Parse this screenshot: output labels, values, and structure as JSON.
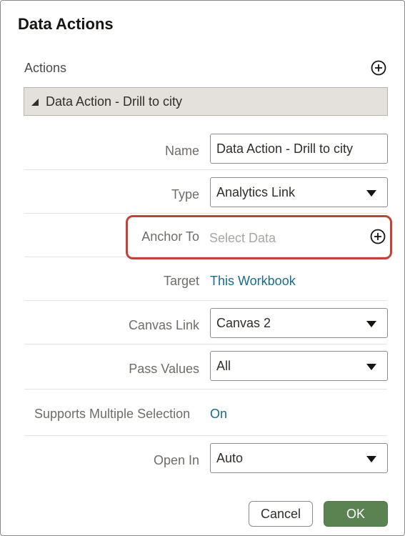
{
  "dialog": {
    "title": "Data Actions"
  },
  "actions": {
    "label": "Actions",
    "add_icon": "add-circle-icon"
  },
  "section": {
    "label": "Data Action - Drill to city",
    "collapse_icon": "triangle-expanded-icon"
  },
  "fields": {
    "name": {
      "label": "Name",
      "value": "Data Action - Drill to city"
    },
    "type": {
      "label": "Type",
      "value": "Analytics Link"
    },
    "anchor_to": {
      "label": "Anchor To",
      "placeholder": "Select Data",
      "add_icon": "add-circle-icon"
    },
    "target": {
      "label": "Target",
      "value": "This Workbook"
    },
    "canvas_link": {
      "label": "Canvas Link",
      "value": "Canvas 2"
    },
    "pass_values": {
      "label": "Pass Values",
      "value": "All"
    },
    "supports_multiple_selection": {
      "label": "Supports Multiple Selection",
      "value": "On"
    },
    "open_in": {
      "label": "Open In",
      "value": "Auto"
    }
  },
  "buttons": {
    "cancel": "Cancel",
    "ok": "OK"
  },
  "colors": {
    "link": "#1a6b8a",
    "highlight": "#c0433a",
    "ok_button": "#5b8251",
    "section_bar": "#e4e1dd"
  }
}
